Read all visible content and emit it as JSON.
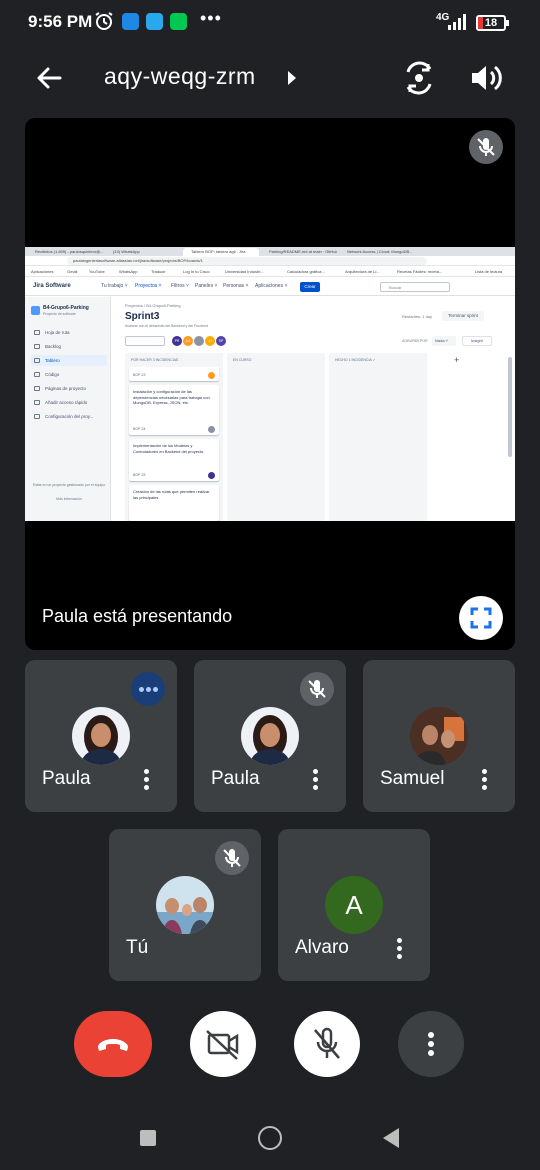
{
  "status_bar": {
    "time": "9:56 PM",
    "network": "4G",
    "battery": "18",
    "apps": [
      "messages-icon",
      "telegram-icon",
      "security-icon"
    ],
    "more": "•••"
  },
  "header": {
    "meeting_code": "aqy-weqg-zrm"
  },
  "presentation": {
    "presenter_label": "Paula está presentando"
  },
  "shared_screen": {
    "tabs": [
      "Recibidos (1.809) - paulosquintero@...",
      "(13) WhatsApp",
      "Tablero BOP: tablero ágil - Jira",
      "Parking/README.md at main · GitHub",
      "Network Access | Cloud: MongoDB..."
    ],
    "url": "paulaingenieriasoftware.atlassian.net/jira/software/projects/BOP/boards/1",
    "bookmarks": [
      "Aplicaciones",
      "Gmail",
      "YouTube",
      "WhatsApp",
      "Traducir",
      "Log In to Cisco",
      "Universidad Industri...",
      "Calculadora gráfica...",
      "Arquitectura de Li...",
      "Recetas Fáciles: receta...",
      "Lista de lectura"
    ],
    "jira": {
      "logo": "Jira Software",
      "nav": [
        "Tu trabajo ˅",
        "Proyectos ˅",
        "Filtros ˅",
        "Paneles ˅",
        "Personas ˅",
        "Aplicaciones ˅"
      ],
      "create": "Crear",
      "search": "Buscar",
      "project_name": "B4-Grupo6-Parking",
      "project_type": "Proyecto de software",
      "sidebar": [
        "Hoja de ruta",
        "Backlog",
        "Tablero",
        "Código",
        "Páginas de proyecto",
        "Añadir acceso rápido",
        "Configuración del proy..."
      ],
      "sidebar_footer": "Estás en un proyecto gestionado por el equipo",
      "sidebar_more": "Más información",
      "breadcrumb": "Proyectos  /  B4-Grupo6-Parking",
      "title": "Sprint3",
      "subtitle": "Avanzar con el desarrollo del Backend y del Frontend",
      "remaining": "Restantes: 1 day",
      "end_sprint": "Terminar sprint",
      "group_by": "AGRUPAR POR",
      "group_value": "Nada ˅",
      "insight": "Insight",
      "avatars": [
        "PR",
        "AG",
        "",
        "JJ",
        "SP"
      ],
      "columns": [
        {
          "title": "POR HACER  3 INCIDENCIAS",
          "cards": [
            {
              "text": "",
              "key": "BOP-23"
            },
            {
              "text": "Instalación y configuración de las dependencias necesarias para trabajar con MongoDB, Express, JSON, etc.",
              "key": "BOP-24"
            },
            {
              "text": "Implementación de los Modelos y Controladores en Backend del proyecto.",
              "key": "BOP-25"
            },
            {
              "text": "Creación de las rutas que permiten realizar las principales",
              "key": ""
            }
          ]
        },
        {
          "title": "EN CURSO",
          "cards": []
        },
        {
          "title": "HECHO  1 INCIDENCIA  ✓",
          "cards": []
        }
      ]
    }
  },
  "participants": [
    {
      "name": "Paula",
      "speaking": true,
      "muted": false
    },
    {
      "name": "Paula",
      "speaking": false,
      "muted": true
    },
    {
      "name": "Samuel",
      "speaking": false,
      "muted": false
    },
    {
      "name": "Tú",
      "speaking": false,
      "muted": true
    },
    {
      "name": "Alvaro",
      "initial": "A",
      "speaking": false,
      "muted": false
    }
  ],
  "controls": {
    "end_call": "end-call-icon",
    "camera": "camera-off-icon",
    "microphone": "mic-off-icon",
    "more": "more-vert-icon"
  },
  "colors": {
    "background": "#202124",
    "tile": "#3c4043",
    "end_call": "#ea4335",
    "accent": "#1a73e8",
    "avatar_alvaro": "#33691e"
  }
}
